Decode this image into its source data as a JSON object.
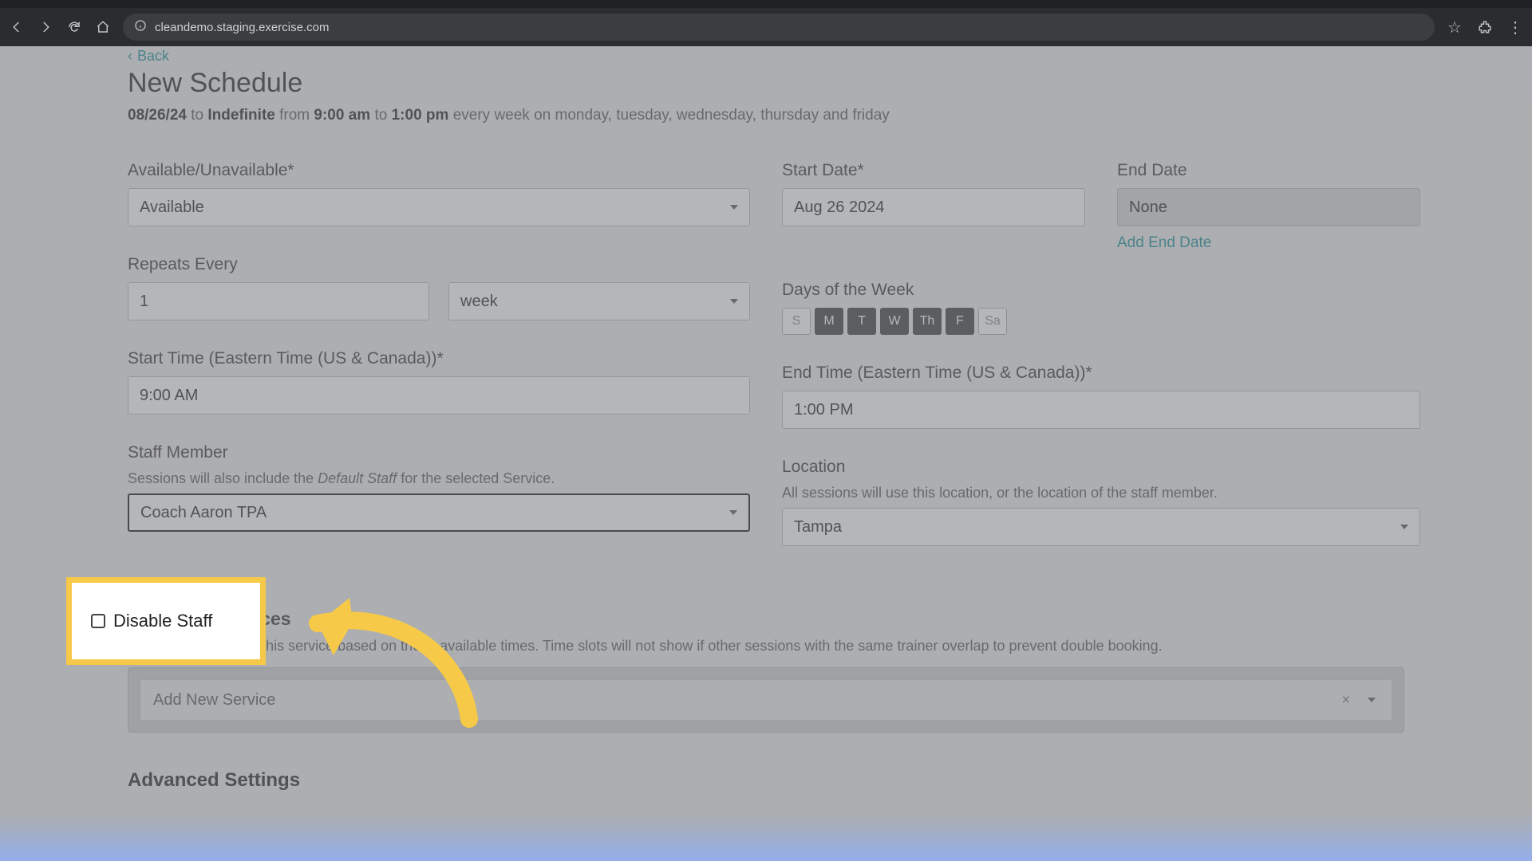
{
  "browser": {
    "url": "cleandemo.staging.exercise.com"
  },
  "header": {
    "back": "Back",
    "title": "New Schedule",
    "summary_date": "08/26/24",
    "summary_to_word": "to",
    "summary_end": "Indefinite",
    "summary_from_word": "from",
    "summary_start_time": "9:00 am",
    "summary_to_word2": "to",
    "summary_end_time": "1:00 pm",
    "summary_tail": "every week on monday, tuesday, wednesday, thursday and friday"
  },
  "labels": {
    "available": "Available/Unavailable*",
    "start_date": "Start Date*",
    "end_date": "End Date",
    "repeats": "Repeats Every",
    "days": "Days of the Week",
    "start_time": "Start Time (Eastern Time (US & Canada))*",
    "end_time": "End Time (Eastern Time (US & Canada))*",
    "staff": "Staff Member",
    "staff_help_a": "Sessions will also include the ",
    "staff_help_i": "Default Staff",
    "staff_help_b": " for the selected Service.",
    "location": "Location",
    "location_help": "All sessions will use this location, or the location of the staff member.",
    "add_end_date": "Add End Date",
    "bookable": "Bookable Services",
    "bookable_help": "Allow clients to book this service based on these available times. Time slots will not show if other sessions with the same trainer overlap to prevent double booking.",
    "add_service_placeholder": "Add New Service",
    "advanced": "Advanced Settings",
    "disable_staff": "Disable Staff"
  },
  "values": {
    "available": "Available",
    "start_date": "Aug 26 2024",
    "end_date": "None",
    "repeats_num": "1",
    "repeats_unit": "week",
    "start_time": "9:00 AM",
    "end_time": "1:00 PM",
    "staff": "Coach Aaron TPA",
    "location": "Tampa"
  },
  "days": [
    {
      "abbr": "S",
      "on": false
    },
    {
      "abbr": "M",
      "on": true
    },
    {
      "abbr": "T",
      "on": true
    },
    {
      "abbr": "W",
      "on": true
    },
    {
      "abbr": "Th",
      "on": true
    },
    {
      "abbr": "F",
      "on": true
    },
    {
      "abbr": "Sa",
      "on": false
    }
  ],
  "colors": {
    "highlight": "#f7c948",
    "teal": "#158f9b"
  }
}
